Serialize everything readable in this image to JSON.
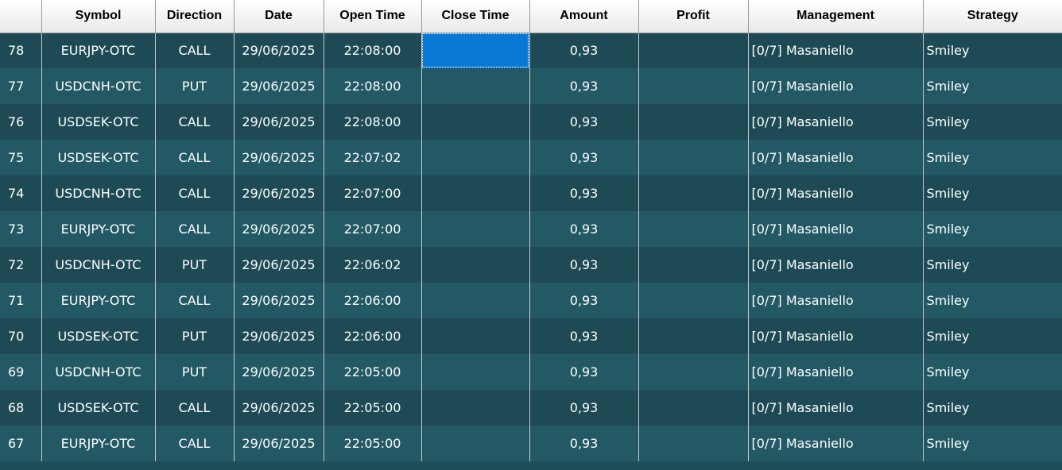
{
  "columns": [
    "",
    "Symbol",
    "Direction",
    "Date",
    "Open Time",
    "Close Time",
    "Amount",
    "Profit",
    "Management",
    "Strategy"
  ],
  "rows": [
    {
      "id": "78",
      "symbol": "EURJPY-OTC",
      "direction": "CALL",
      "date": "29/06/2025",
      "open_time": "22:08:00",
      "close_time": "",
      "amount": "0,93",
      "profit": "",
      "management": "[0/7] Masaniello",
      "strategy": "Smiley"
    },
    {
      "id": "77",
      "symbol": "USDCNH-OTC",
      "direction": "PUT",
      "date": "29/06/2025",
      "open_time": "22:08:00",
      "close_time": "",
      "amount": "0,93",
      "profit": "",
      "management": "[0/7] Masaniello",
      "strategy": "Smiley"
    },
    {
      "id": "76",
      "symbol": "USDSEK-OTC",
      "direction": "CALL",
      "date": "29/06/2025",
      "open_time": "22:08:00",
      "close_time": "",
      "amount": "0,93",
      "profit": "",
      "management": "[0/7] Masaniello",
      "strategy": "Smiley"
    },
    {
      "id": "75",
      "symbol": "USDSEK-OTC",
      "direction": "CALL",
      "date": "29/06/2025",
      "open_time": "22:07:02",
      "close_time": "",
      "amount": "0,93",
      "profit": "",
      "management": "[0/7] Masaniello",
      "strategy": "Smiley"
    },
    {
      "id": "74",
      "symbol": "USDCNH-OTC",
      "direction": "CALL",
      "date": "29/06/2025",
      "open_time": "22:07:00",
      "close_time": "",
      "amount": "0,93",
      "profit": "",
      "management": "[0/7] Masaniello",
      "strategy": "Smiley"
    },
    {
      "id": "73",
      "symbol": "EURJPY-OTC",
      "direction": "CALL",
      "date": "29/06/2025",
      "open_time": "22:07:00",
      "close_time": "",
      "amount": "0,93",
      "profit": "",
      "management": "[0/7] Masaniello",
      "strategy": "Smiley"
    },
    {
      "id": "72",
      "symbol": "USDCNH-OTC",
      "direction": "PUT",
      "date": "29/06/2025",
      "open_time": "22:06:02",
      "close_time": "",
      "amount": "0,93",
      "profit": "",
      "management": "[0/7] Masaniello",
      "strategy": "Smiley"
    },
    {
      "id": "71",
      "symbol": "EURJPY-OTC",
      "direction": "CALL",
      "date": "29/06/2025",
      "open_time": "22:06:00",
      "close_time": "",
      "amount": "0,93",
      "profit": "",
      "management": "[0/7] Masaniello",
      "strategy": "Smiley"
    },
    {
      "id": "70",
      "symbol": "USDSEK-OTC",
      "direction": "PUT",
      "date": "29/06/2025",
      "open_time": "22:06:00",
      "close_time": "",
      "amount": "0,93",
      "profit": "",
      "management": "[0/7] Masaniello",
      "strategy": "Smiley"
    },
    {
      "id": "69",
      "symbol": "USDCNH-OTC",
      "direction": "PUT",
      "date": "29/06/2025",
      "open_time": "22:05:00",
      "close_time": "",
      "amount": "0,93",
      "profit": "",
      "management": "[0/7] Masaniello",
      "strategy": "Smiley"
    },
    {
      "id": "68",
      "symbol": "USDSEK-OTC",
      "direction": "CALL",
      "date": "29/06/2025",
      "open_time": "22:05:00",
      "close_time": "",
      "amount": "0,93",
      "profit": "",
      "management": "[0/7] Masaniello",
      "strategy": "Smiley"
    },
    {
      "id": "67",
      "symbol": "EURJPY-OTC",
      "direction": "CALL",
      "date": "29/06/2025",
      "open_time": "22:05:00",
      "close_time": "",
      "amount": "0,93",
      "profit": "",
      "management": "[0/7] Masaniello",
      "strategy": "Smiley"
    }
  ],
  "selection": {
    "row": 0,
    "column": "close_time"
  },
  "colors": {
    "row_dark": "#1d4a55",
    "row_light": "#235965",
    "header_bg": "#f2f2f2",
    "selection": "#0a78d7"
  }
}
